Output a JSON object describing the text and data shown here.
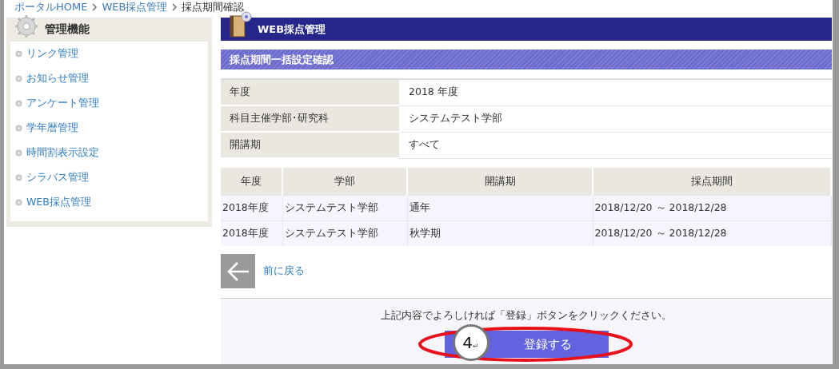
{
  "breadcrumb": [
    {
      "label": "ポータルHOME",
      "link": true
    },
    {
      "label": "WEB採点管理",
      "link": true
    },
    {
      "label": "採点期間確認",
      "link": false
    }
  ],
  "sidebar": {
    "title": "管理機能",
    "items": [
      "リンク管理",
      "お知らせ管理",
      "アンケート管理",
      "学年暦管理",
      "時間割表示設定",
      "シラバス管理",
      "WEB採点管理"
    ]
  },
  "page_title": "WEB採点管理",
  "section_title": "採点期間一括設定確認",
  "info": [
    {
      "label": "年度",
      "value": "2018 年度"
    },
    {
      "label": "科目主催学部･研究科",
      "value": "システムテスト学部"
    },
    {
      "label": "開講期",
      "value": "すべて"
    }
  ],
  "table": {
    "columns": [
      "年度",
      "学部",
      "開講期",
      "採点期間"
    ],
    "rows": [
      [
        "2018年度",
        "システムテスト学部",
        "通年",
        "2018/12/20 ～ 2018/12/28"
      ],
      [
        "2018年度",
        "システムテスト学部",
        "秋学期",
        "2018/12/20 ～ 2018/12/28"
      ]
    ]
  },
  "back_link": "前に戻る",
  "message": "上記内容でよろしければ「登録」ボタンをクリックください。",
  "submit_button": "登録する",
  "annotation": {
    "number": "4",
    "mark": "↵"
  }
}
